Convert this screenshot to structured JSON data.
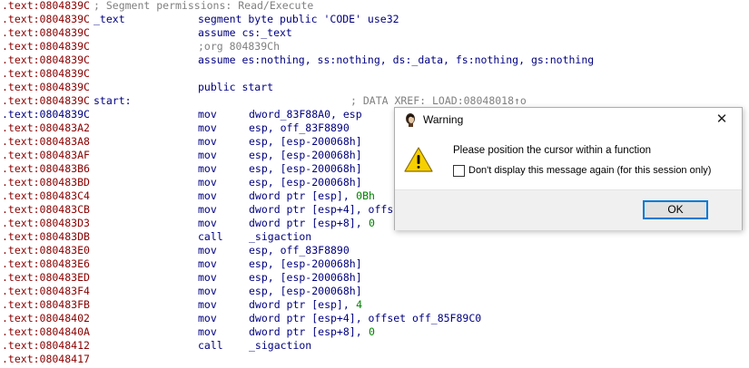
{
  "listing": [
    {
      "addr": ".text:0804839C",
      "comment": "; Segment permissions: Read/Execute"
    },
    {
      "addr": ".text:0804839C",
      "label": "_text",
      "instr": "segment byte public 'CODE' use32"
    },
    {
      "addr": ".text:0804839C",
      "instr": "assume cs:_text"
    },
    {
      "addr": ".text:0804839C",
      "comment_instr": ";org 804839Ch"
    },
    {
      "addr": ".text:0804839C",
      "instr": "assume es:nothing, ss:nothing, ds:_data, fs:nothing, gs:nothing"
    },
    {
      "addr": ".text:0804839C"
    },
    {
      "addr": ".text:0804839C",
      "instr": "public start"
    },
    {
      "addr": ".text:0804839C",
      "label": "start:",
      "xref": "; DATA XREF: LOAD:08048018↑o"
    },
    {
      "addr": ".text:0804839C",
      "current": true,
      "instr": "mov",
      "ops": "dword_83F88A0, esp"
    },
    {
      "addr": ".text:080483A2",
      "instr": "mov",
      "ops": "esp, off_83F8890"
    },
    {
      "addr": ".text:080483A8",
      "instr": "mov",
      "ops": "esp, [esp-200068h]"
    },
    {
      "addr": ".text:080483AF",
      "instr": "mov",
      "ops": "esp, [esp-200068h]"
    },
    {
      "addr": ".text:080483B6",
      "instr": "mov",
      "ops": "esp, [esp-200068h]"
    },
    {
      "addr": ".text:080483BD",
      "instr": "mov",
      "ops": "esp, [esp-200068h]"
    },
    {
      "addr": ".text:080483C4",
      "instr": "mov",
      "ops": "dword ptr [esp], ",
      "num": "0Bh"
    },
    {
      "addr": ".text:080483CB",
      "instr": "mov",
      "ops": "dword ptr [esp+4], offs"
    },
    {
      "addr": ".text:080483D3",
      "instr": "mov",
      "ops": "dword ptr [esp+8], ",
      "num": "0"
    },
    {
      "addr": ".text:080483DB",
      "instr": "call",
      "ops": "_sigaction"
    },
    {
      "addr": ".text:080483E0",
      "instr": "mov",
      "ops": "esp, off_83F8890"
    },
    {
      "addr": ".text:080483E6",
      "instr": "mov",
      "ops": "esp, [esp-200068h]"
    },
    {
      "addr": ".text:080483ED",
      "instr": "mov",
      "ops": "esp, [esp-200068h]"
    },
    {
      "addr": ".text:080483F4",
      "instr": "mov",
      "ops": "esp, [esp-200068h]"
    },
    {
      "addr": ".text:080483FB",
      "instr": "mov",
      "ops": "dword ptr [esp], ",
      "num": "4"
    },
    {
      "addr": ".text:08048402",
      "instr": "mov",
      "ops": "dword ptr [esp+4], offset off_85F89C0"
    },
    {
      "addr": ".text:0804840A",
      "instr": "mov",
      "ops": "dword ptr [esp+8], ",
      "num": "0"
    },
    {
      "addr": ".text:08048412",
      "instr": "call",
      "ops": "_sigaction"
    },
    {
      "addr": ".text:08048417"
    }
  ],
  "dialog": {
    "title": "Warning",
    "message": "Please position the cursor within a function",
    "checkbox_label": "Don't display this message again (for this session only)",
    "checkbox_checked": false,
    "ok_label": "OK",
    "close_glyph": "✕",
    "title_icon": "ida-app-icon",
    "warning_icon": "warning-triangle-icon"
  },
  "colors": {
    "address": "#8b0000",
    "current_address": "#000080",
    "code": "#000080",
    "comment": "#808080",
    "number": "#008000",
    "ok_border": "#0078d7"
  }
}
